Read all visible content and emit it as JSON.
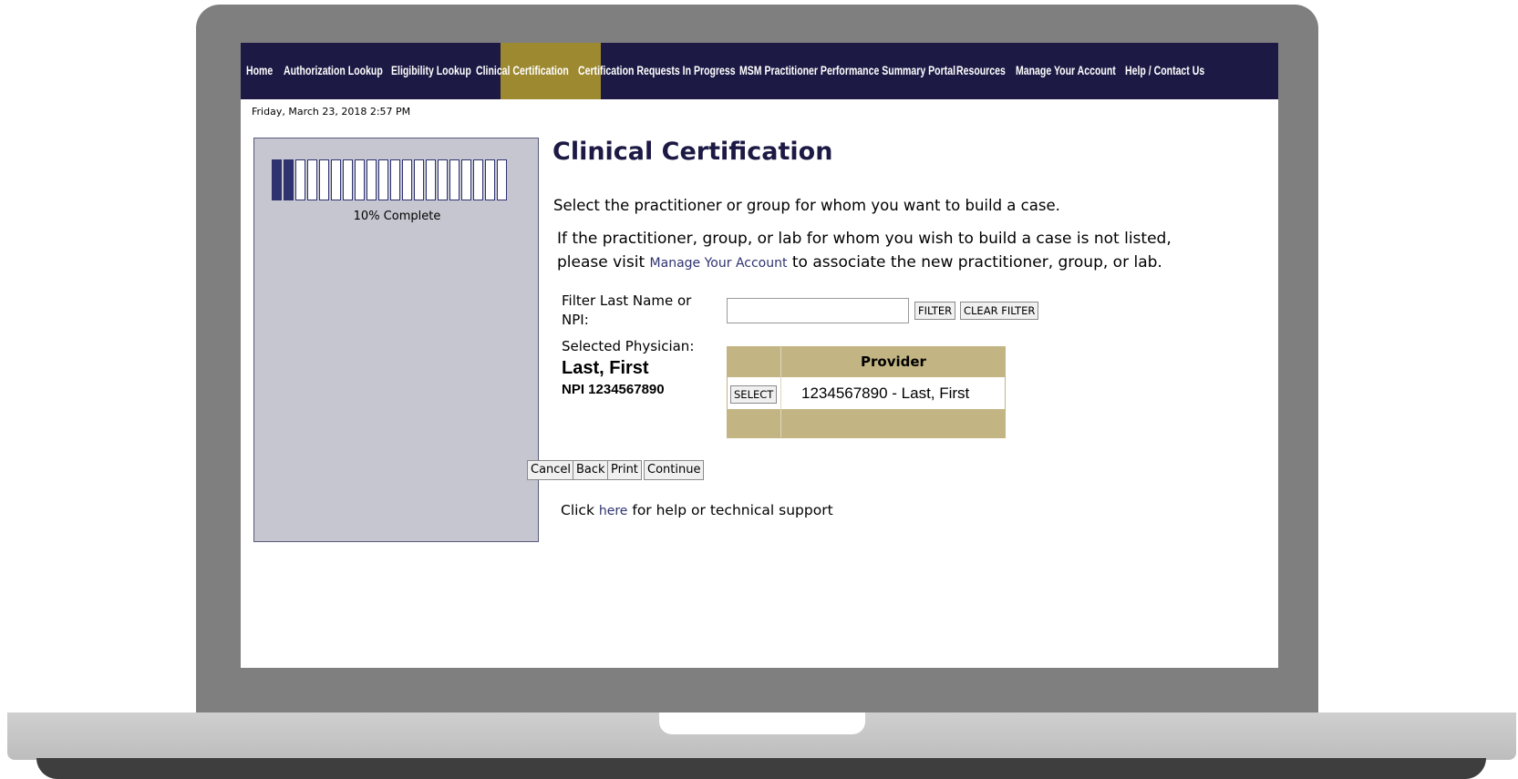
{
  "nav": {
    "items": [
      {
        "label": "Home"
      },
      {
        "label": "Authorization Lookup"
      },
      {
        "label": "Eligibility Lookup"
      },
      {
        "label": "Clinical Certification",
        "active": true
      },
      {
        "label": "Certification Requests In Progress"
      },
      {
        "label": "MSM Practitioner Performance Summary Portal"
      },
      {
        "label": "Resources"
      },
      {
        "label": "Manage Your Account"
      },
      {
        "label": "Help / Contact Us"
      }
    ],
    "active_color": "#9d8930",
    "bar_color": "#1c1a44"
  },
  "datetime": "Friday, March 23, 2018 2:57 PM",
  "progress": {
    "percent": 10,
    "filled_segments": 2,
    "total_segments": 20,
    "label": "10% Complete"
  },
  "page": {
    "title": "Clinical Certification",
    "instruction_1": "Select the practitioner or group for whom you want to build a case.",
    "instruction_2_before": "If the practitioner, group, or lab for whom you wish to build a case is not listed, please visit ",
    "manage_link": "Manage Your Account",
    "instruction_2_after": " to associate the new practitioner, group, or lab."
  },
  "filter": {
    "label": "Filter Last Name or NPI:",
    "value": "",
    "filter_button": "FILTER",
    "clear_button": "CLEAR FILTER"
  },
  "selected": {
    "label": "Selected Physician:",
    "name": "Last, First",
    "npi": "NPI 1234567890"
  },
  "provider_table": {
    "header": "Provider",
    "rows": [
      {
        "select_label": "SELECT",
        "provider": "1234567890 - Last, First"
      }
    ],
    "header_color": "#c3b583"
  },
  "actions": {
    "cancel": "Cancel",
    "back": "Back",
    "print": "Print",
    "continue": "Continue"
  },
  "help": {
    "before": "Click ",
    "link": "here",
    "after": " for help or technical support"
  }
}
